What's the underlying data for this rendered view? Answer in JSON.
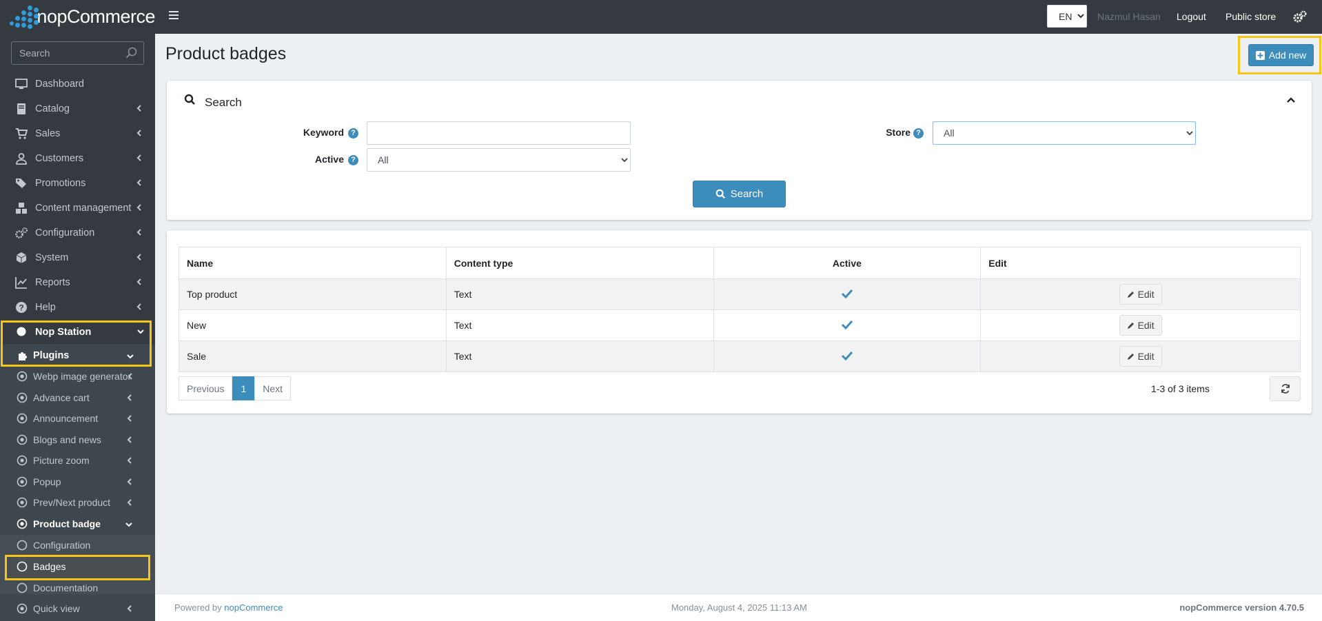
{
  "brand": {
    "name": "nopCommerce",
    "accent": "#2f9bd9"
  },
  "header": {
    "language": "EN",
    "user": "Nazmul Hasan",
    "logout": "Logout",
    "public_store": "Public store"
  },
  "sidebar": {
    "search_placeholder": "Search",
    "items": [
      {
        "label": "Dashboard",
        "icon": "monitor-icon"
      },
      {
        "label": "Catalog",
        "icon": "book-icon"
      },
      {
        "label": "Sales",
        "icon": "cart-icon"
      },
      {
        "label": "Customers",
        "icon": "user-icon"
      },
      {
        "label": "Promotions",
        "icon": "tags-icon"
      },
      {
        "label": "Content management",
        "icon": "cubes-icon"
      },
      {
        "label": "Configuration",
        "icon": "gears-icon"
      },
      {
        "label": "System",
        "icon": "cube-icon"
      },
      {
        "label": "Reports",
        "icon": "chart-icon"
      },
      {
        "label": "Help",
        "icon": "question-icon"
      },
      {
        "label": "Nop Station",
        "icon": "circle-icon"
      },
      {
        "label": "Plugins",
        "icon": "puzzle-icon"
      }
    ],
    "plugins": [
      {
        "label": "Webp image generator"
      },
      {
        "label": "Advance cart"
      },
      {
        "label": "Announcement"
      },
      {
        "label": "Blogs and news"
      },
      {
        "label": "Picture zoom"
      },
      {
        "label": "Popup"
      },
      {
        "label": "Prev/Next product"
      },
      {
        "label": "Product badge"
      },
      {
        "label": "Configuration"
      },
      {
        "label": "Badges"
      },
      {
        "label": "Documentation"
      },
      {
        "label": "Quick view"
      }
    ]
  },
  "page": {
    "title": "Product badges",
    "add_new": "Add new"
  },
  "search_panel": {
    "title": "Search",
    "keyword_label": "Keyword",
    "keyword_value": "",
    "active_label": "Active",
    "active_value": "All",
    "store_label": "Store",
    "store_value": "All",
    "search_button": "Search"
  },
  "grid": {
    "columns": [
      "Name",
      "Content type",
      "Active",
      "Edit"
    ],
    "rows": [
      {
        "name": "Top product",
        "content_type": "Text",
        "active": true,
        "edit": "Edit"
      },
      {
        "name": "New",
        "content_type": "Text",
        "active": true,
        "edit": "Edit"
      },
      {
        "name": "Sale",
        "content_type": "Text",
        "active": true,
        "edit": "Edit"
      }
    ],
    "pager": {
      "previous": "Previous",
      "current": "1",
      "next": "Next"
    },
    "summary": "1-3 of 3 items"
  },
  "footer": {
    "powered_prefix": "Powered by",
    "powered_link": "nopCommerce",
    "datetime": "Monday, August 4, 2025 11:13 AM",
    "version": "nopCommerce version 4.70.5"
  },
  "colors": {
    "primary": "#3c8dbc",
    "sidebar": "#343a40",
    "highlight": "#f5c518"
  }
}
